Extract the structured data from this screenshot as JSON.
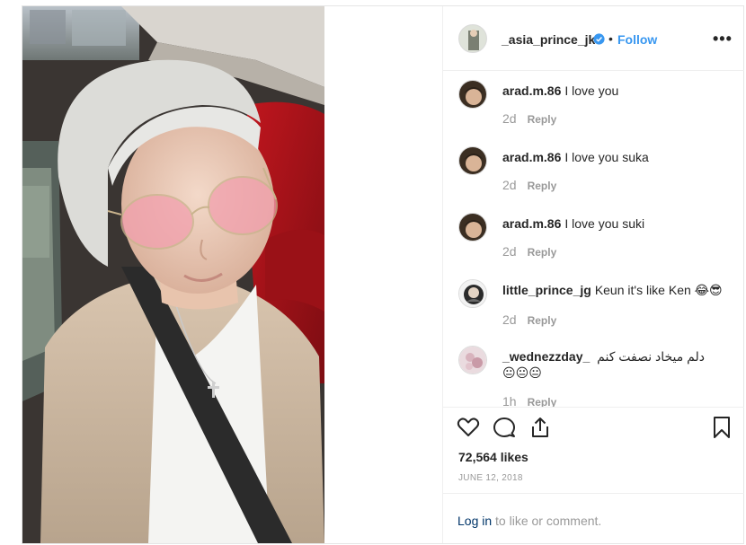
{
  "post": {
    "author": "_asia_prince_jks",
    "follow_label": "Follow",
    "separator": "•",
    "more_icon": "more-options-icon"
  },
  "comments": [
    {
      "user": "arad.m.86",
      "text": "I love you",
      "time": "2d",
      "reply": "Reply"
    },
    {
      "user": "arad.m.86",
      "text": "I love you suka",
      "time": "2d",
      "reply": "Reply"
    },
    {
      "user": "arad.m.86",
      "text": "I love you suki",
      "time": "2d",
      "reply": "Reply"
    },
    {
      "user": "little_prince_jg",
      "text": "Keun it's like Ken 😂😎",
      "time": "2d",
      "reply": "Reply"
    },
    {
      "user": "_wednezzday_",
      "text": "دلم ميخاد نصفت كنم😐😐😐",
      "time": "1h",
      "reply": "Reply"
    }
  ],
  "stats": {
    "likes": "72,564 likes",
    "date": "JUNE 12, 2018"
  },
  "footer": {
    "login_link": "Log in",
    "login_rest": " to like or comment."
  },
  "colors": {
    "accent": "#3897f0",
    "muted": "#999999",
    "border": "#efefef"
  }
}
